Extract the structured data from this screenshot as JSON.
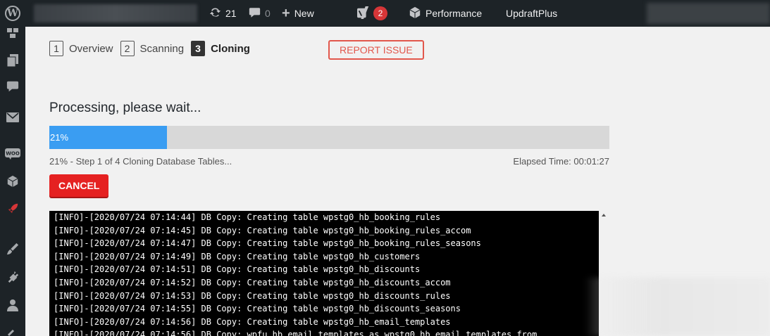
{
  "adminbar": {
    "updates_count": "21",
    "comments_count": "0",
    "new_label": "New",
    "yoast_badge": "2",
    "performance_label": "Performance",
    "updraft_label": "UpdraftPlus"
  },
  "steps": [
    {
      "num": "1",
      "label": "Overview"
    },
    {
      "num": "2",
      "label": "Scanning"
    },
    {
      "num": "3",
      "label": "Cloning"
    }
  ],
  "report_button": "REPORT ISSUE",
  "processing_title": "Processing, please wait...",
  "progress": {
    "percent": 21,
    "label": "21%",
    "status": "21% - Step 1 of 4 Cloning Database Tables...",
    "elapsed": "Elapsed Time: 00:01:27"
  },
  "cancel_button": "CANCEL",
  "log_lines": [
    "[INFO]-[2020/07/24 07:14:44] DB Copy: Creating table wpstg0_hb_booking_rules",
    "[INFO]-[2020/07/24 07:14:45] DB Copy: Creating table wpstg0_hb_booking_rules_accom",
    "[INFO]-[2020/07/24 07:14:47] DB Copy: Creating table wpstg0_hb_booking_rules_seasons",
    "[INFO]-[2020/07/24 07:14:49] DB Copy: Creating table wpstg0_hb_customers",
    "[INFO]-[2020/07/24 07:14:51] DB Copy: Creating table wpstg0_hb_discounts",
    "[INFO]-[2020/07/24 07:14:52] DB Copy: Creating table wpstg0_hb_discounts_accom",
    "[INFO]-[2020/07/24 07:14:53] DB Copy: Creating table wpstg0_hb_discounts_rules",
    "[INFO]-[2020/07/24 07:14:55] DB Copy: Creating table wpstg0_hb_discounts_seasons",
    "[INFO]-[2020/07/24 07:14:56] DB Copy: Creating table wpstg0_hb_email_templates",
    "[INFO]-[2020/07/24 07:14:56] DB Copy: wpfu_hb_email_templates as wpstg0_hb_email_templates from"
  ],
  "colors": {
    "adminbar_bg": "#1d2327",
    "progress_fill": "#3a9df2",
    "cancel_bg": "#e52121",
    "report_border": "#e2574c"
  }
}
